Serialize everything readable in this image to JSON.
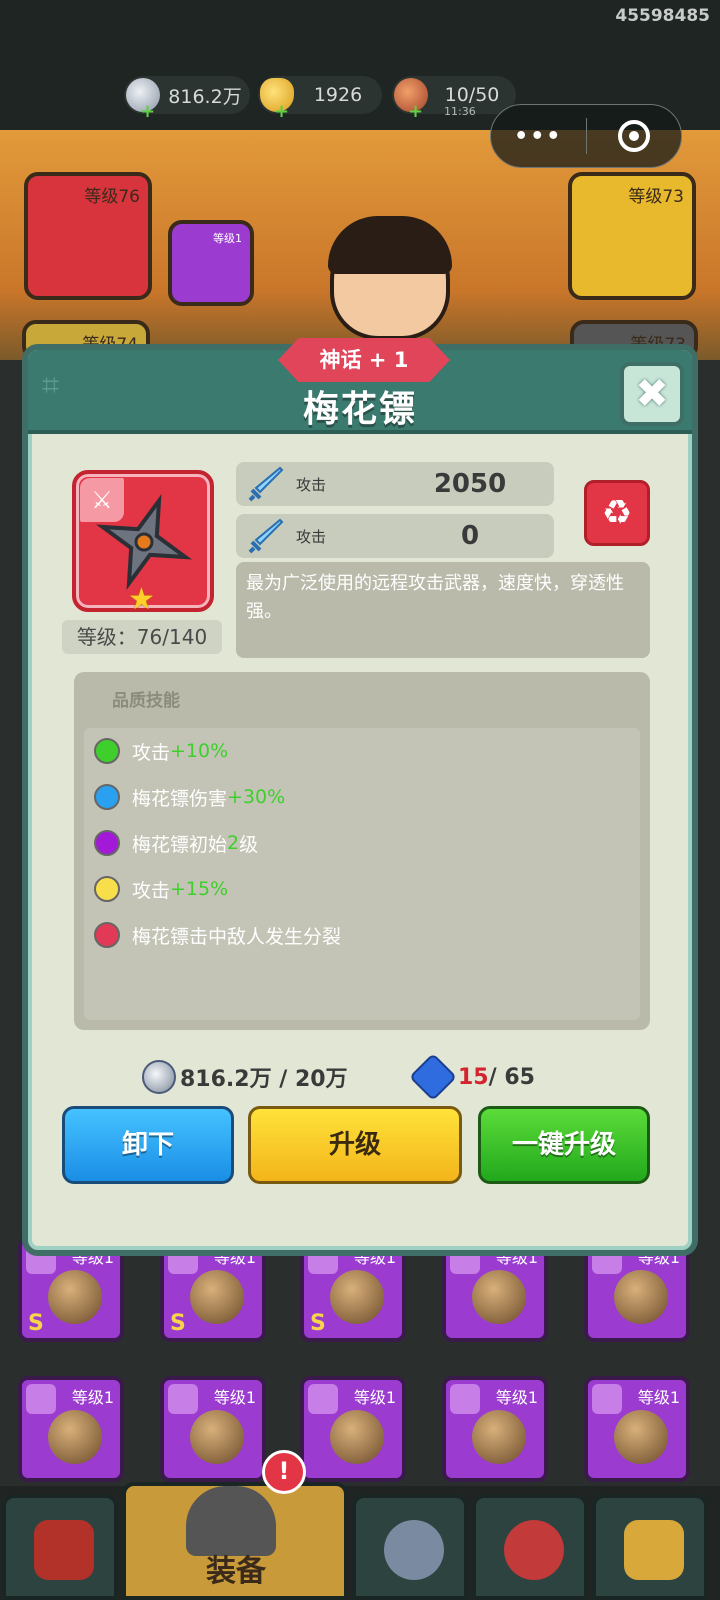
{
  "header": {
    "uid": "45598485",
    "silver": "816.2万",
    "gold": "1926",
    "stamina": "10/50",
    "stamina_timer": "11:36",
    "plus": "+"
  },
  "capsule": {
    "menu_glyph": "•••"
  },
  "background_slots": {
    "weapon_level": "等级76",
    "pet_level": "等级1",
    "armor_level": "等级73",
    "slot4_level": "等级74",
    "slot5_level": "等级73"
  },
  "modal": {
    "rank_badge": "神话 + 1",
    "title": "梅花镖",
    "close_glyph": "✖",
    "item_level": "等级：76/140",
    "stats": [
      {
        "label": "攻击",
        "value": "2050"
      },
      {
        "label": "攻击",
        "value": "0"
      }
    ],
    "recycle_glyph": "♻",
    "description": "最为广泛使用的远程攻击武器，速度快，穿透性强。",
    "skills_title": "品质技能",
    "skills": [
      {
        "dot_color": "#3ecf2c",
        "text": "攻击",
        "bonus": "+10%"
      },
      {
        "dot_color": "#2aa0f0",
        "text": "梅花镖伤害",
        "bonus": "+30%"
      },
      {
        "dot_color": "#a21ad8",
        "text": "梅花镖初始",
        "bonus": "2",
        "suffix": "级"
      },
      {
        "dot_color": "#f7de4a",
        "text": "攻击",
        "bonus": "+15%"
      },
      {
        "dot_color": "#e23a56",
        "text": "梅花镖击中敌人发生分裂",
        "bonus": ""
      }
    ],
    "cost_silver": "816.2万 / 20万",
    "cost_gem_have": "15",
    "cost_gem_need": " / 65",
    "buttons": {
      "unequip": "卸下",
      "upgrade": "升级",
      "one_click_upgrade": "一键升级"
    }
  },
  "inventory": {
    "row1": [
      "等级1",
      "等级1",
      "等级1",
      "等级1",
      "等级1"
    ],
    "row2": [
      "等级1",
      "等级1",
      "等级1",
      "等级1",
      "等级1"
    ],
    "grade_s": "S"
  },
  "nav": {
    "active_label": "装备",
    "alert": "!"
  }
}
